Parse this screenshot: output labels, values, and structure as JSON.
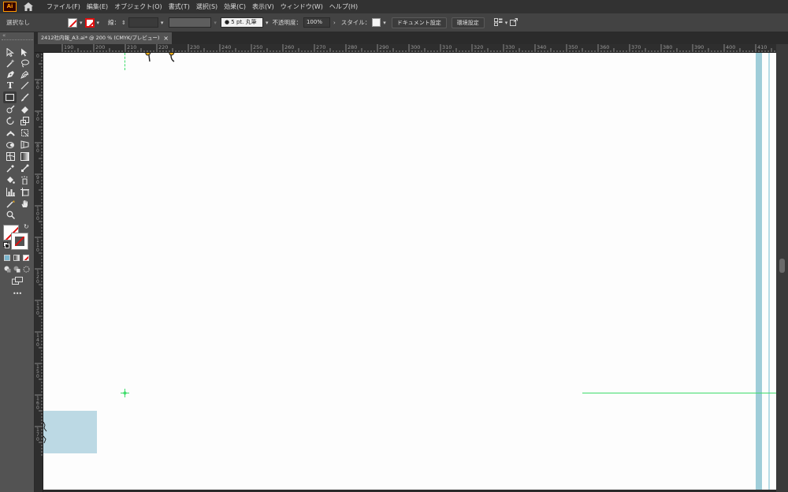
{
  "app": {
    "logo_text": "Ai"
  },
  "menu": [
    "ファイル(F)",
    "編集(E)",
    "オブジェクト(O)",
    "書式(T)",
    "選択(S)",
    "効果(C)",
    "表示(V)",
    "ウィンドウ(W)",
    "ヘルプ(H)"
  ],
  "control_bar": {
    "selection_status": "選択なし",
    "stroke_label": "線：",
    "brush_value": "5 pt. 丸筆",
    "opacity_label": "不透明度：",
    "opacity_value": "100%",
    "style_label": "スタイル：",
    "document_setup_button": "ドキュメント設定",
    "preferences_button": "環境設定"
  },
  "document_tab": {
    "title": "2412社内報_A3.ai* @ 200 % (CMYK/プレビュー)",
    "close": "×"
  },
  "rulers": {
    "top": [
      "190",
      "200",
      "210",
      "220",
      "230",
      "240",
      "250",
      "260",
      "270",
      "280",
      "290",
      "300",
      "310",
      "320",
      "330",
      "340",
      "350",
      "360",
      "370",
      "380",
      "390",
      "400",
      "410"
    ],
    "left": [
      "50",
      "60",
      "70",
      "80",
      "90",
      "100",
      "110",
      "120",
      "130",
      "140",
      "150",
      "160",
      "170"
    ]
  },
  "tool_panel": {
    "more_tools": "•••"
  },
  "colors": {
    "guide_green": "#3ddc6a",
    "bleed_blue": "#9fcdd9",
    "selection_fill": "#bcd9e4",
    "character_yellow": "#f4b21c",
    "artboard": "#fdfdfd"
  }
}
